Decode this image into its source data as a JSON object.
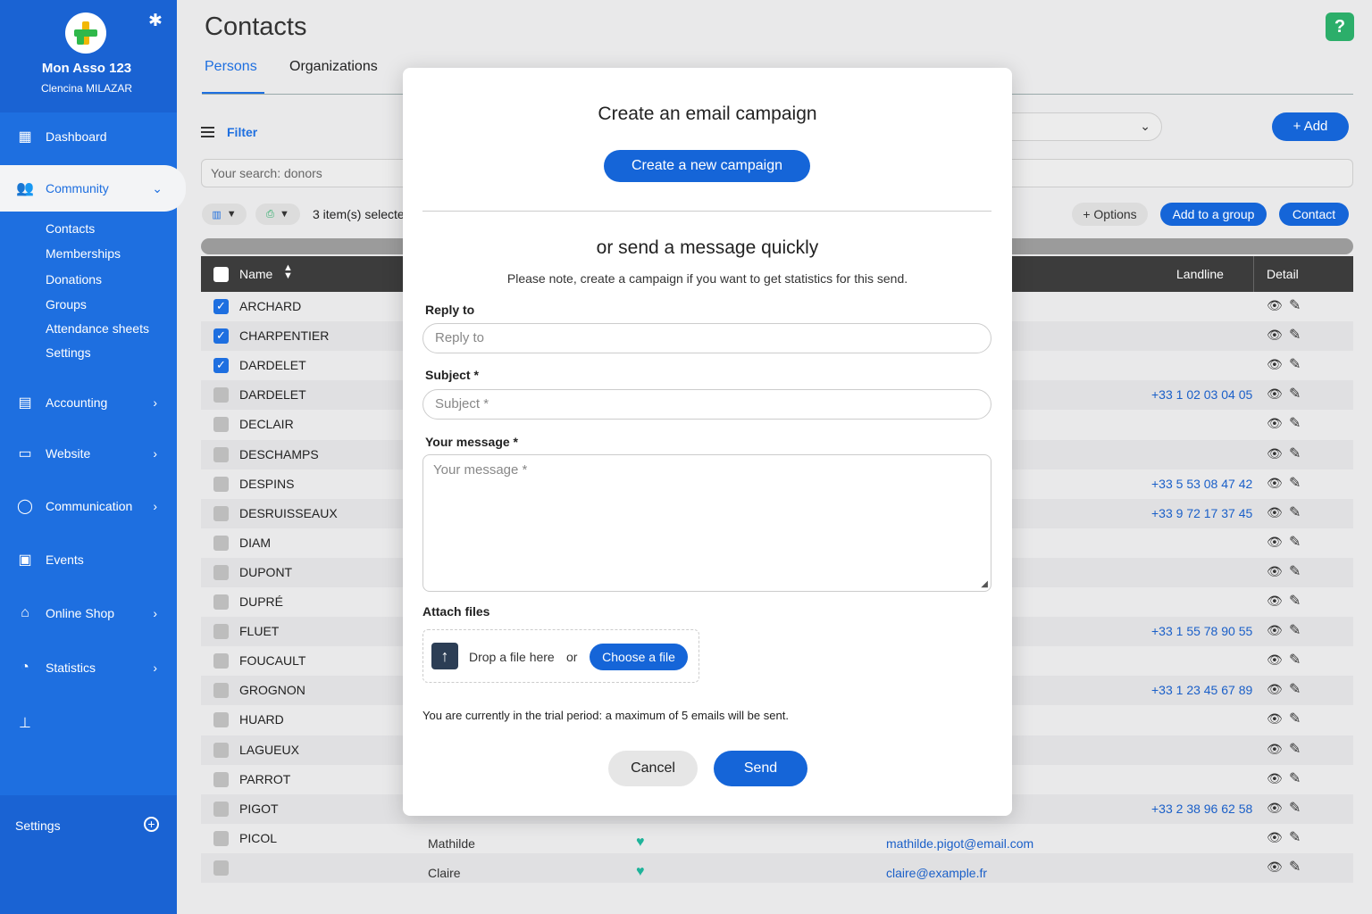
{
  "sidebar": {
    "org_name": "Mon Asso 123",
    "user_name": "Clencina MILAZAR",
    "dashboard": "Dashboard",
    "community": "Community",
    "community_items": [
      "Contacts",
      "Memberships",
      "Donations",
      "Groups",
      "Attendance sheets",
      "Settings"
    ],
    "accounting": "Accounting",
    "website": "Website",
    "communication": "Communication",
    "events": "Events",
    "online_shop": "Online Shop",
    "statistics": "Statistics",
    "settings": "Settings"
  },
  "header": {
    "title": "Contacts",
    "tabs": [
      "Persons",
      "Organizations"
    ],
    "help": "?"
  },
  "toolbar": {
    "filter": "Filter",
    "add": "+ Add",
    "search_value": "Your search: donors",
    "selected": "3 item(s) selecte",
    "options": "+ Options",
    "add_to_group": "Add to a group",
    "contact": "Contact"
  },
  "table": {
    "headers": {
      "name": "Name",
      "landline": "Landline",
      "detail": "Detail"
    },
    "rows": [
      {
        "name": "ARCHARD",
        "checked": true,
        "phone": ""
      },
      {
        "name": "CHARPENTIER",
        "checked": true,
        "phone": ""
      },
      {
        "name": "DARDELET",
        "checked": true,
        "phone": ""
      },
      {
        "name": "DARDELET",
        "checked": false,
        "phone": "+33 1 02 03 04 05"
      },
      {
        "name": "DECLAIR",
        "checked": false,
        "phone": ""
      },
      {
        "name": "DESCHAMPS",
        "checked": false,
        "phone": ""
      },
      {
        "name": "DESPINS",
        "checked": false,
        "phone": "+33 5 53 08 47 42"
      },
      {
        "name": "DESRUISSEAUX",
        "checked": false,
        "phone": "+33 9 72 17 37 45"
      },
      {
        "name": "DIAM",
        "checked": false,
        "phone": ""
      },
      {
        "name": "DUPONT",
        "checked": false,
        "phone": ""
      },
      {
        "name": "DUPRÉ",
        "checked": false,
        "phone": ""
      },
      {
        "name": "FLUET",
        "checked": false,
        "phone": "+33 1 55 78 90 55"
      },
      {
        "name": "FOUCAULT",
        "checked": false,
        "phone": ""
      },
      {
        "name": "GROGNON",
        "checked": false,
        "phone": "+33 1 23 45 67 89"
      },
      {
        "name": "HUARD",
        "checked": false,
        "phone": ""
      },
      {
        "name": "LAGUEUX",
        "checked": false,
        "phone": ""
      },
      {
        "name": "PARROT",
        "checked": false,
        "phone": ""
      },
      {
        "name": "PIGOT",
        "checked": false,
        "phone": "+33 2 38 96 62 58"
      },
      {
        "name": "PICOL",
        "checked": false,
        "phone": "",
        "first_name": "Mathilde",
        "email": "mathilde.pigot@email.com"
      },
      {
        "name": "",
        "checked": false,
        "phone": "",
        "first_name": "Claire",
        "email": "claire@example.fr"
      }
    ]
  },
  "modal": {
    "title": "Create an email campaign",
    "create_button": "Create a new campaign",
    "subtitle": "or send a message quickly",
    "note": "Please note, create a campaign if you want to get statistics for this send.",
    "reply_label": "Reply to",
    "reply_placeholder": "Reply to",
    "subject_label": "Subject *",
    "subject_placeholder": "Subject *",
    "message_label": "Your message *",
    "message_placeholder": "Your message *",
    "attach_label": "Attach files",
    "drop_text": "Drop a file here",
    "or_text": "or",
    "choose_file": "Choose a file",
    "trial_note": "You are currently in the trial period: a maximum of 5 emails will be sent.",
    "cancel": "Cancel",
    "send": "Send"
  }
}
